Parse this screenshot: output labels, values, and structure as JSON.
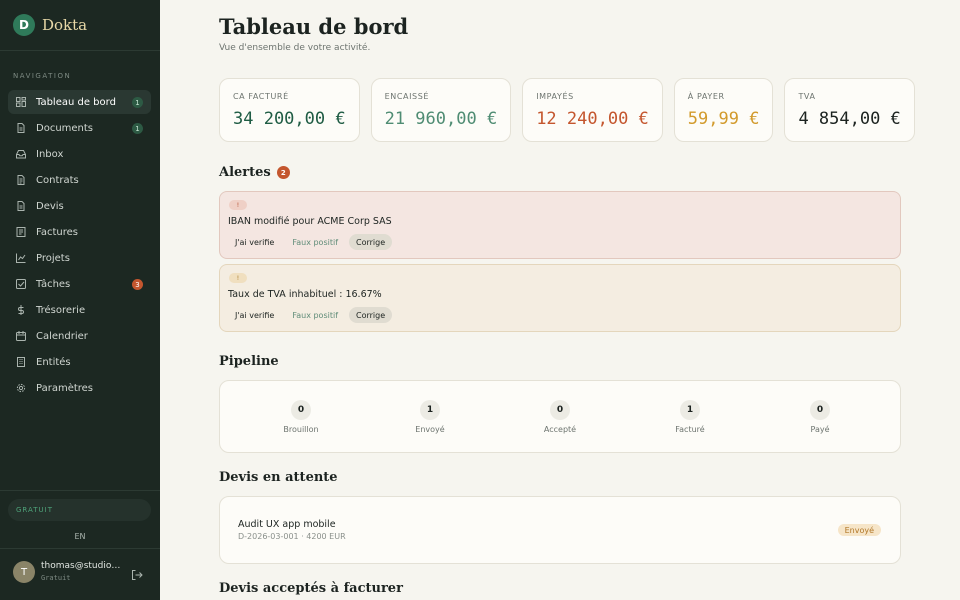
{
  "app": {
    "logo_letter": "D",
    "name": "Dokta"
  },
  "sidebar": {
    "section_label": "NAVIGATION",
    "items": [
      {
        "label": "Tableau de bord",
        "icon": "dashboard-icon",
        "badge": "1",
        "active": true
      },
      {
        "label": "Documents",
        "icon": "document-icon",
        "badge": "1"
      },
      {
        "label": "Inbox",
        "icon": "inbox-icon",
        "badge": ""
      },
      {
        "label": "Contrats",
        "icon": "contract-icon",
        "badge": ""
      },
      {
        "label": "Devis",
        "icon": "quote-icon",
        "badge": ""
      },
      {
        "label": "Factures",
        "icon": "invoice-icon",
        "badge": ""
      },
      {
        "label": "Projets",
        "icon": "chart-icon",
        "badge": ""
      },
      {
        "label": "Tâches",
        "icon": "checkbox-icon",
        "badge": "3"
      },
      {
        "label": "Trésorerie",
        "icon": "dollar-icon",
        "badge": ""
      },
      {
        "label": "Calendrier",
        "icon": "calendar-icon",
        "badge": ""
      },
      {
        "label": "Entités",
        "icon": "building-icon",
        "badge": ""
      },
      {
        "label": "Paramètres",
        "icon": "gear-icon",
        "badge": ""
      }
    ],
    "plan_label": "GRATUIT",
    "language": "EN",
    "user": {
      "initial": "T",
      "email": "thomas@studiow...",
      "plan": "Gratuit"
    }
  },
  "header": {
    "title": "Tableau de bord",
    "subtitle": "Vue d'ensemble de votre activité."
  },
  "kpis": [
    {
      "label": "CA FACTURÉ",
      "value": "34 200,00 €",
      "color": "#1f5c44"
    },
    {
      "label": "ENCAISSÉ",
      "value": "21 960,00 €",
      "color": "#4f8c73"
    },
    {
      "label": "IMPAYÉS",
      "value": "12 240,00 €",
      "color": "#c4562e"
    },
    {
      "label": "À PAYER",
      "value": "59,99 €",
      "color": "#d29a2c"
    },
    {
      "label": "TVA",
      "value": "4 854,00 €",
      "color": "#1c2320"
    }
  ],
  "alerts": {
    "title": "Alertes",
    "count": "2",
    "items": [
      {
        "tag": "!",
        "text": "IBAN modifié pour ACME Corp SAS",
        "verify": "J'ai verifie",
        "false_positive": "Faux positif",
        "fix": "Corrige"
      },
      {
        "tag": "!",
        "text": "Taux de TVA inhabituel : 16.67%",
        "verify": "J'ai verifie",
        "false_positive": "Faux positif",
        "fix": "Corrige"
      }
    ]
  },
  "pipeline": {
    "title": "Pipeline",
    "stages": [
      {
        "count": "0",
        "label": "Brouillon"
      },
      {
        "count": "1",
        "label": "Envoyé"
      },
      {
        "count": "0",
        "label": "Accepté"
      },
      {
        "count": "1",
        "label": "Facturé"
      },
      {
        "count": "0",
        "label": "Payé"
      }
    ]
  },
  "pending_quotes": {
    "title": "Devis en attente",
    "items": [
      {
        "title": "Audit UX app mobile",
        "meta": "D-2026-03-001 · 4200 EUR",
        "status": "Envoyé"
      }
    ]
  },
  "accepted_quotes": {
    "title": "Devis acceptés à facturer"
  }
}
